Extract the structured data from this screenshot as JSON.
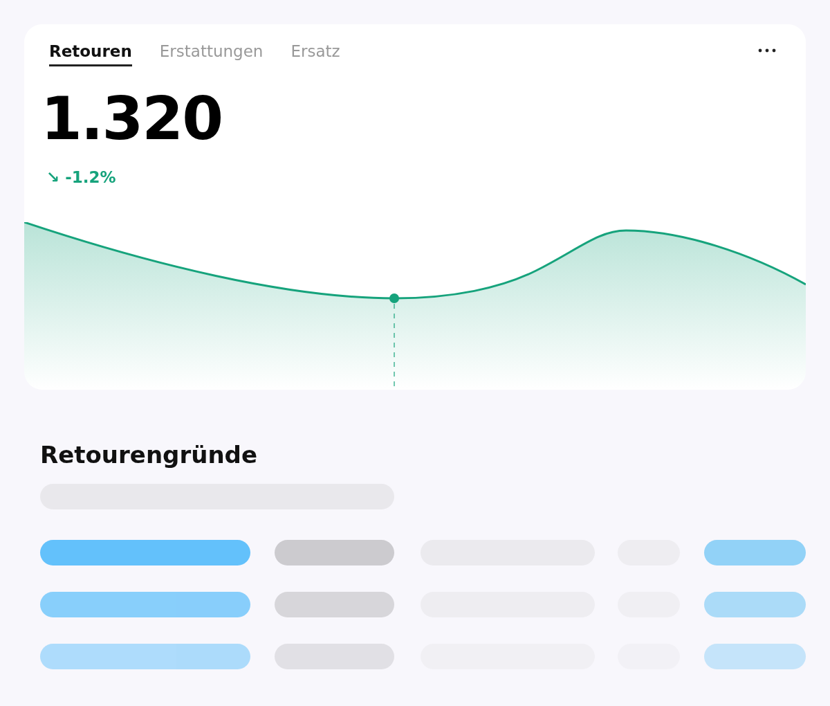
{
  "tabs": [
    {
      "label": "Retouren",
      "selected": true
    },
    {
      "label": "Erstattungen",
      "selected": false
    },
    {
      "label": "Ersatz",
      "selected": false
    }
  ],
  "metric": {
    "value": "1.320",
    "change": {
      "icon": "↘",
      "text": "-1.2%"
    }
  },
  "reasons": {
    "title": "Retourengründe"
  }
}
